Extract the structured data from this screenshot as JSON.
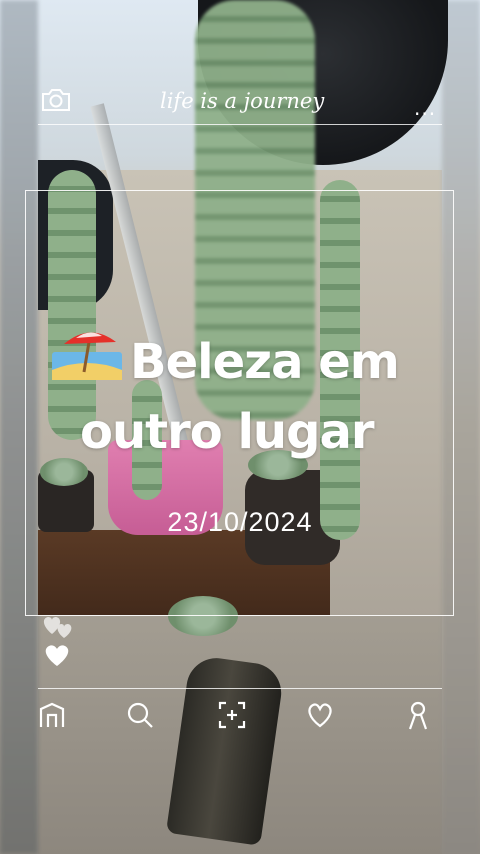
{
  "header": {
    "title": "life is a journey",
    "camera_icon": "camera-icon",
    "more_label": "..."
  },
  "story": {
    "emoji": "beach-umbrella-emoji",
    "caption_line1": "Beleza em",
    "caption_line2": "outro lugar",
    "date": "23/10/2024"
  },
  "reactions": {
    "icons": [
      "heart-stack-icon",
      "heart-icon"
    ]
  },
  "bottom_nav": {
    "items": [
      {
        "icon": "home-icon"
      },
      {
        "icon": "search-icon"
      },
      {
        "icon": "add-capture-icon"
      },
      {
        "icon": "heart-outline-icon"
      },
      {
        "icon": "profile-icon"
      }
    ]
  },
  "colors": {
    "overlay_text": "#ffffff",
    "frame_border": "#ffffff"
  }
}
